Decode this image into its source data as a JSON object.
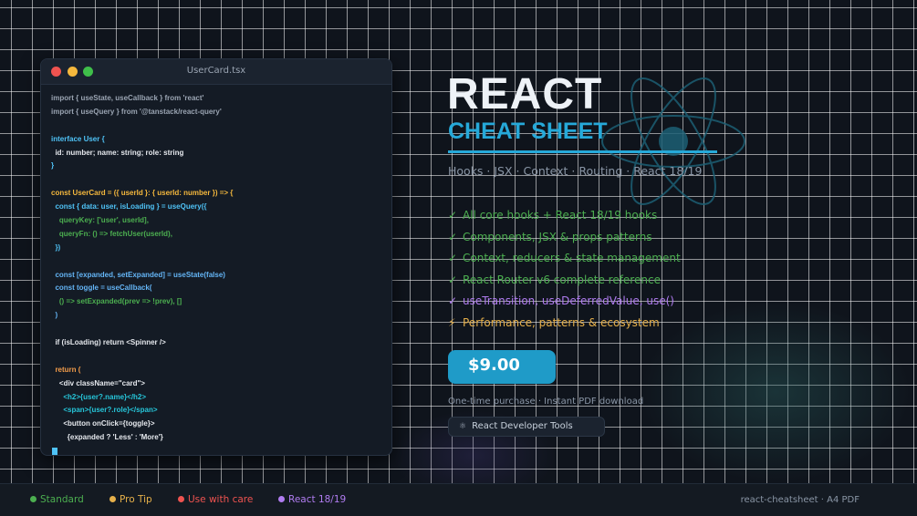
{
  "editor": {
    "filename": "UserCard.tsx",
    "lines": [
      {
        "text": "import { useState, useCallback } from 'react'",
        "color": "#9aa4b2"
      },
      {
        "text": "import { useQuery } from '@tanstack/react-query'",
        "color": "#9aa4b2"
      },
      {
        "text": "",
        "color": "#9aa4b2"
      },
      {
        "text": "interface User {",
        "color": "#4fc3f7"
      },
      {
        "text": "  id: number; name: string; role: string",
        "color": "#e6e9ee"
      },
      {
        "text": "}",
        "color": "#4fc3f7"
      },
      {
        "text": "",
        "color": "#9aa4b2"
      },
      {
        "text": "const UserCard = ({ userId }: { userId: number }) => {",
        "color": "#f5b83d"
      },
      {
        "text": "  const { data: user, isLoading } = useQuery({",
        "color": "#4fc3f7"
      },
      {
        "text": "    queryKey: ['user', userId],",
        "color": "#4caf50"
      },
      {
        "text": "    queryFn: () => fetchUser(userId),",
        "color": "#4caf50"
      },
      {
        "text": "  })",
        "color": "#4fc3f7"
      },
      {
        "text": "",
        "color": "#9aa4b2"
      },
      {
        "text": "  const [expanded, setExpanded] = useState(false)",
        "color": "#64b5f6"
      },
      {
        "text": "  const toggle = useCallback(",
        "color": "#64b5f6"
      },
      {
        "text": "    () => setExpanded(prev => !prev), []",
        "color": "#4caf50"
      },
      {
        "text": "  )",
        "color": "#64b5f6"
      },
      {
        "text": "",
        "color": "#9aa4b2"
      },
      {
        "text": "  if (isLoading) return <Spinner />",
        "color": "#e6e9ee"
      },
      {
        "text": "",
        "color": "#9aa4b2"
      },
      {
        "text": "  return (",
        "color": "#f39c4a"
      },
      {
        "text": "    <div className=\"card\">",
        "color": "#e6e9ee"
      },
      {
        "text": "      <h2>{user?.name}</h2>",
        "color": "#26c6da"
      },
      {
        "text": "      <span>{user?.role}</span>",
        "color": "#26c6da"
      },
      {
        "text": "      <button onClick={toggle}>",
        "color": "#e6e9ee"
      },
      {
        "text": "        {expanded ? 'Less' : 'More'}",
        "color": "#e6e9ee"
      }
    ]
  },
  "hero": {
    "title": "REACT",
    "subtitle": "CHEAT SHEET",
    "tagline": "Hooks · JSX · Context · Routing · React 18/19"
  },
  "features": [
    {
      "mark": "✓",
      "text": "All core hooks + React 18/19 hooks",
      "color": "#4caf50"
    },
    {
      "mark": "✓",
      "text": "Components, JSX & props patterns",
      "color": "#4caf50"
    },
    {
      "mark": "✓",
      "text": "Context, reducers & state management",
      "color": "#4caf50"
    },
    {
      "mark": "✓",
      "text": "React Router v6 complete reference",
      "color": "#4caf50"
    },
    {
      "mark": "✓",
      "text": "useTransition, useDeferredValue, use()",
      "color": "#b07cf0"
    },
    {
      "mark": "⚡",
      "text": "Performance, patterns & ecosystem",
      "color": "#e6b04a"
    }
  ],
  "purchase": {
    "price": "$9.00",
    "note": "One-time purchase · Instant PDF download",
    "tools_label": "React Developer Tools",
    "tools_icon": "atom-icon"
  },
  "footer": {
    "legend": [
      {
        "label": "Standard",
        "color": "#4caf50"
      },
      {
        "label": "Pro Tip",
        "color": "#e6b04a"
      },
      {
        "label": "Use with care",
        "color": "#ef5350"
      },
      {
        "label": "React 18/19",
        "color": "#b07cf0"
      }
    ],
    "right_text": "react-cheatsheet  ·  A4 PDF"
  },
  "colors": {
    "accent": "#26a9d9",
    "background": "#0f141c",
    "panel": "#141b25"
  }
}
